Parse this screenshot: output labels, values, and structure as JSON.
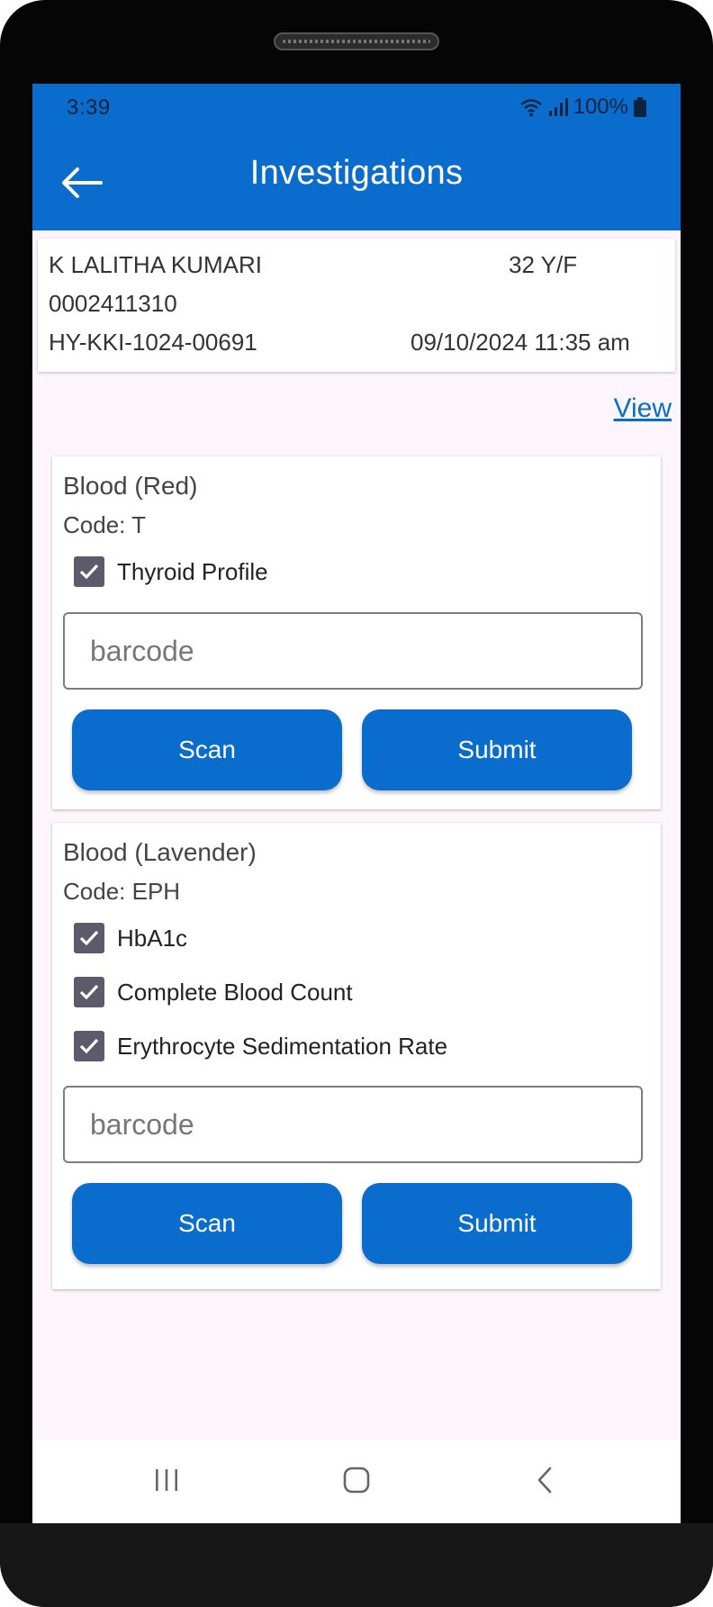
{
  "status_bar": {
    "time": "3:39",
    "battery": "100%"
  },
  "header": {
    "title": "Investigations"
  },
  "patient": {
    "name": "K LALITHA KUMARI",
    "age_gender": "32 Y/F",
    "patient_id": "0002411310",
    "visit_id": "HY-KKI-1024-00691",
    "datetime": "09/10/2024 11:35 am"
  },
  "view_link": "View",
  "groups": [
    {
      "title": "Blood (Red)",
      "code": "Code: T",
      "tests": [
        {
          "label": "Thyroid Profile",
          "checked": true
        }
      ],
      "barcode_placeholder": "barcode",
      "barcode_value": "",
      "scan_label": "Scan",
      "submit_label": "Submit"
    },
    {
      "title": "Blood (Lavender)",
      "code": "Code: EPH",
      "tests": [
        {
          "label": "HbA1c",
          "checked": true
        },
        {
          "label": "Complete Blood Count",
          "checked": true
        },
        {
          "label": "Erythrocyte Sedimentation Rate",
          "checked": true
        }
      ],
      "barcode_placeholder": "barcode",
      "barcode_value": "",
      "scan_label": "Scan",
      "submit_label": "Submit"
    }
  ],
  "colors": {
    "primary": "#0a6dcd",
    "checkbox": "#5c5a6b",
    "background": "#fcf6fc"
  },
  "icons": [
    "back-arrow-icon",
    "wifi-icon",
    "signal-icon",
    "battery-icon",
    "checkmark-icon",
    "recent-apps-icon",
    "home-icon",
    "nav-back-icon"
  ]
}
